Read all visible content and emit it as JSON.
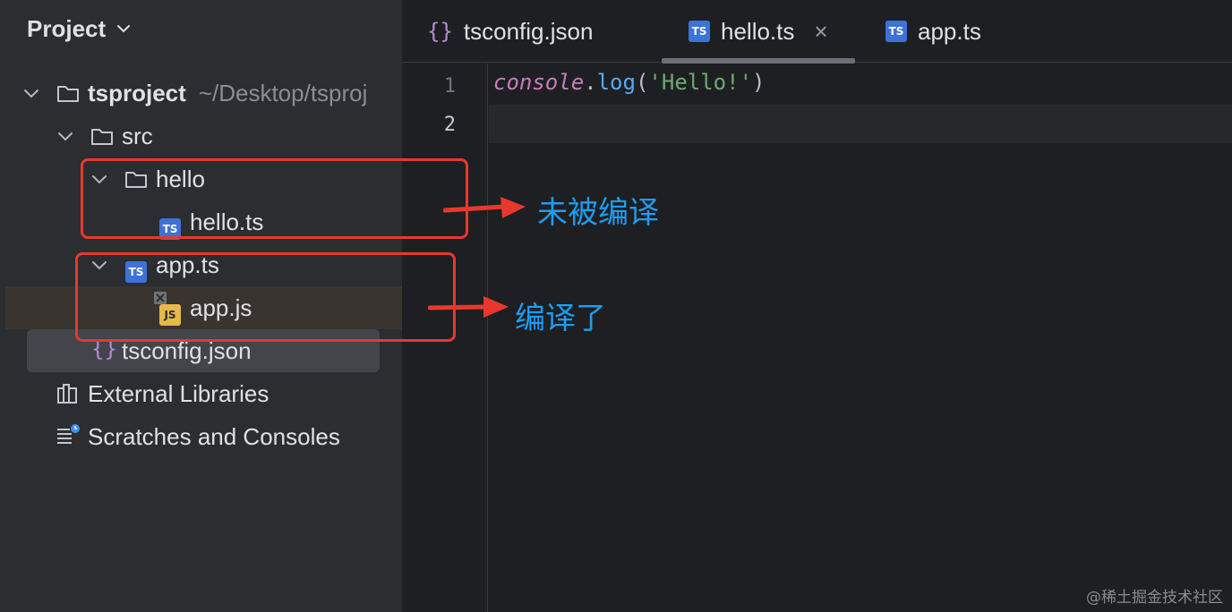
{
  "panel": {
    "title": "Project",
    "tree": {
      "root_label": "tsproject",
      "root_path": "~/Desktop/tsproj",
      "src_label": "src",
      "hello_folder_label": "hello",
      "hello_ts_label": "hello.ts",
      "app_ts_label": "app.ts",
      "app_js_label": "app.js",
      "tsconfig_label": "tsconfig.json",
      "external_libraries_label": "External Libraries",
      "scratches_label": "Scratches and Consoles"
    }
  },
  "tabs": [
    {
      "label": "tsconfig.json",
      "icon": "json-icon"
    },
    {
      "label": "hello.ts",
      "icon": "ts-file-icon",
      "active": true,
      "close": "×"
    },
    {
      "label": "app.ts",
      "icon": "ts-file-icon"
    }
  ],
  "badges": {
    "ts": "TS",
    "js": "JS",
    "json": "{}"
  },
  "editor": {
    "line_numbers": [
      "1",
      "2"
    ],
    "code": {
      "object": "console",
      "dot": ".",
      "method": "log",
      "open_paren": "(",
      "string": "'Hello!'",
      "close_paren": ")"
    }
  },
  "annotations": {
    "not_compiled": "未被编译",
    "compiled": "编译了",
    "color_box": "#e8382d",
    "color_text": "#1f9cf0"
  },
  "watermark": "@稀土掘金技术社区"
}
